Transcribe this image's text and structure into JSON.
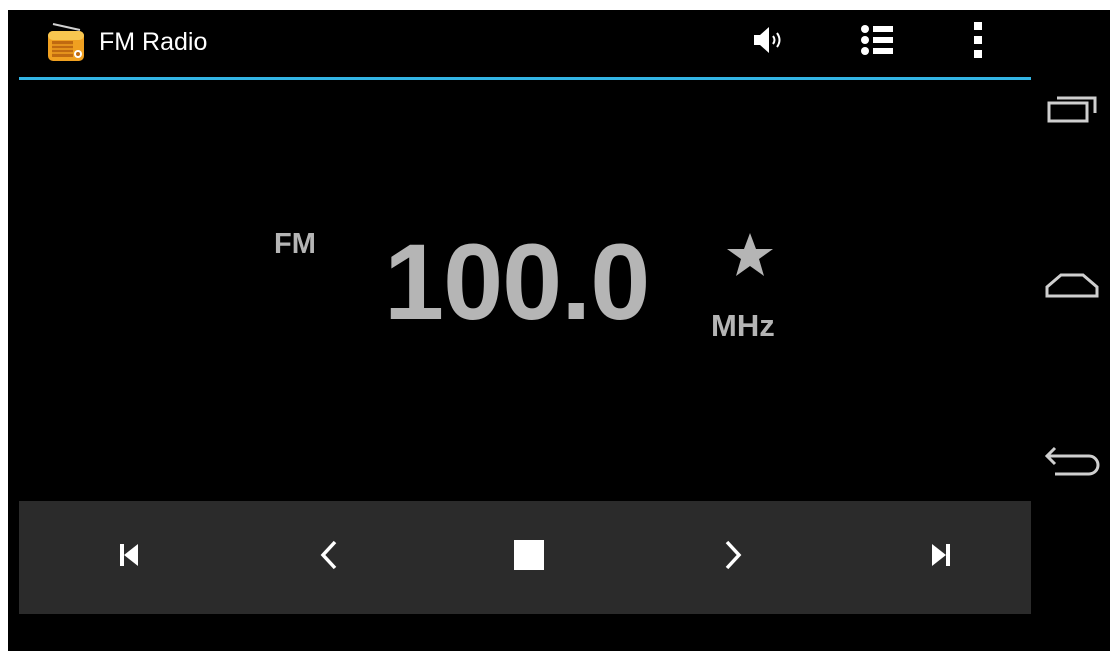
{
  "app": {
    "title": "FM Radio",
    "icon": "radio-icon"
  },
  "action_bar": {
    "actions": [
      {
        "name": "speaker-icon"
      },
      {
        "name": "list-icon"
      },
      {
        "name": "overflow-menu-icon"
      }
    ],
    "accent_color": "#33b5e5"
  },
  "tuner": {
    "band": "FM",
    "frequency": "100.0",
    "unit": "MHz",
    "favorite_icon": "star-icon"
  },
  "transport": {
    "buttons": [
      {
        "name": "skip-previous-icon"
      },
      {
        "name": "seek-back-icon"
      },
      {
        "name": "stop-icon"
      },
      {
        "name": "seek-forward-icon"
      },
      {
        "name": "skip-next-icon"
      }
    ],
    "background": "#2b2b2b"
  },
  "navigation": {
    "buttons": [
      {
        "name": "recent-apps-icon"
      },
      {
        "name": "home-icon"
      },
      {
        "name": "back-icon"
      }
    ]
  },
  "colors": {
    "background": "#000000",
    "text": "#b5b5b5",
    "title_text": "#ffffff"
  }
}
